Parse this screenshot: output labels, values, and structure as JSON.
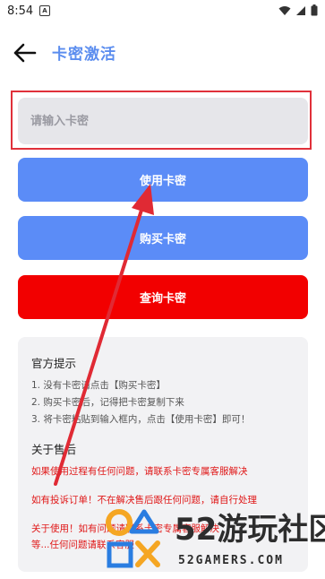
{
  "status_bar": {
    "time": "8:54",
    "notification_badge": "A"
  },
  "header": {
    "title": "卡密激活"
  },
  "input": {
    "placeholder": "请输入卡密",
    "value": ""
  },
  "buttons": {
    "use": "使用卡密",
    "buy": "购买卡密",
    "query": "查询卡密"
  },
  "tips": {
    "title": "官方提示",
    "lines": [
      "1. 没有卡密请点击【购买卡密】",
      "2. 购买卡密后，记得把卡密复制下来",
      "3. 将卡密粘贴到输入框内，点击【使用卡密】即可！"
    ]
  },
  "after_sales": {
    "title": "关于售后",
    "lines": [
      "如果使用过程有任何问题，请联系卡密专属客服解决",
      "如有投诉订单！不在解决售后跟任何问题，请自行处理",
      "关于使用！如有问题请联系卡密专属客服解决",
      "等...任何问题请联系客服"
    ]
  },
  "watermark": {
    "brand": "52游玩社区",
    "site": "52GAMERS.COM"
  },
  "colors": {
    "accent": "#5b8cf7",
    "title": "#5b8def",
    "danger": "#f20000",
    "highlight_box": "#e0303a",
    "annotation_arrow": "#e02a34"
  }
}
